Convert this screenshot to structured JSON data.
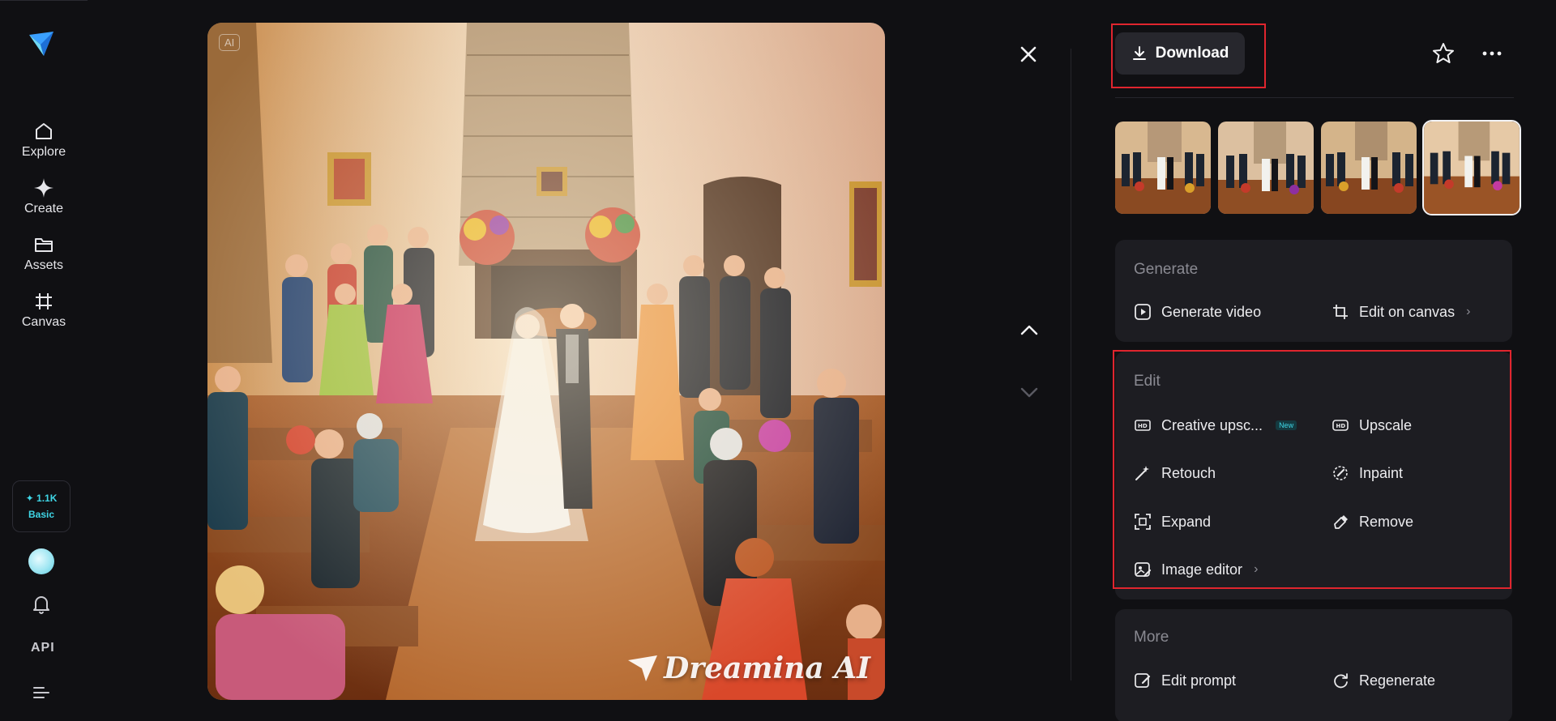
{
  "nav": {
    "items": [
      {
        "label": "Explore",
        "icon": "home-icon"
      },
      {
        "label": "Create",
        "icon": "sparkle-icon"
      },
      {
        "label": "Assets",
        "icon": "folder-icon"
      },
      {
        "label": "Canvas",
        "icon": "canvas-grid-icon"
      }
    ],
    "credits_amount": "1.1K",
    "plan": "Basic",
    "api_label": "API"
  },
  "image": {
    "ai_badge": "AI",
    "watermark": "Dreamina AI",
    "description_alt": "Oil-painting style wedding scene in a stone chapel"
  },
  "actions": {
    "download_label": "Download"
  },
  "thumbnails": {
    "count": 4,
    "selected_index": 3
  },
  "generate": {
    "title": "Generate",
    "items": [
      {
        "label": "Generate video",
        "icon": "play-square-icon"
      },
      {
        "label": "Edit on canvas",
        "icon": "crop-icon",
        "chevron": "›"
      }
    ]
  },
  "edit": {
    "title": "Edit",
    "items": [
      {
        "label": "Creative upsc...",
        "icon": "hd-plus-icon",
        "badge": "New"
      },
      {
        "label": "Upscale",
        "icon": "hd-icon"
      },
      {
        "label": "Retouch",
        "icon": "magic-wand-icon"
      },
      {
        "label": "Inpaint",
        "icon": "inpaint-brush-icon"
      },
      {
        "label": "Expand",
        "icon": "expand-icon"
      },
      {
        "label": "Remove",
        "icon": "eraser-icon"
      },
      {
        "label": "Image editor",
        "icon": "image-edit-icon",
        "chevron": "›"
      }
    ]
  },
  "more": {
    "title": "More",
    "items": [
      {
        "label": "Edit prompt",
        "icon": "edit-prompt-icon"
      },
      {
        "label": "Regenerate",
        "icon": "regenerate-icon"
      }
    ]
  },
  "colors": {
    "background": "#101013",
    "card": "#1d1d22",
    "highlight": "#e0252e",
    "accent": "#3fd6e6"
  }
}
